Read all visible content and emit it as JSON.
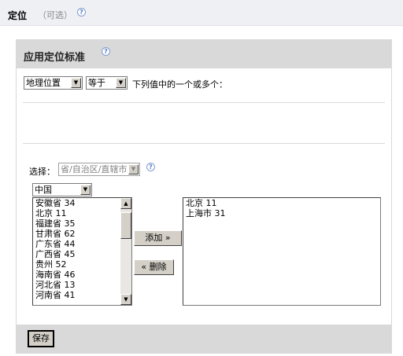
{
  "header": {
    "title": "定位",
    "optional": "（可选）",
    "help_icon": "?"
  },
  "panel": {
    "title": "应用定位标准",
    "help_icon": "?"
  },
  "criteria": {
    "field_select": "地理位置",
    "operator_select": "等于",
    "suffix_text": "下列值中的一个或多个："
  },
  "picker": {
    "label": "选择：",
    "level_select": "省/自治区/直辖市",
    "country_select": "中国"
  },
  "available": [
    "安徽省  34",
    "北京  11",
    "福建省  35",
    "甘肃省  62",
    "广东省  44",
    "广西省  45",
    "贵州  52",
    "海南省  46",
    "河北省  13",
    "河南省  41"
  ],
  "available_scroll_position": 0.05,
  "selected": [
    "北京  11",
    "上海市  31"
  ],
  "buttons": {
    "add": "添加  »",
    "remove": "«  删除",
    "save": "保存"
  },
  "icons": {
    "arrow_down": "▼",
    "arrow_up": "▲"
  }
}
